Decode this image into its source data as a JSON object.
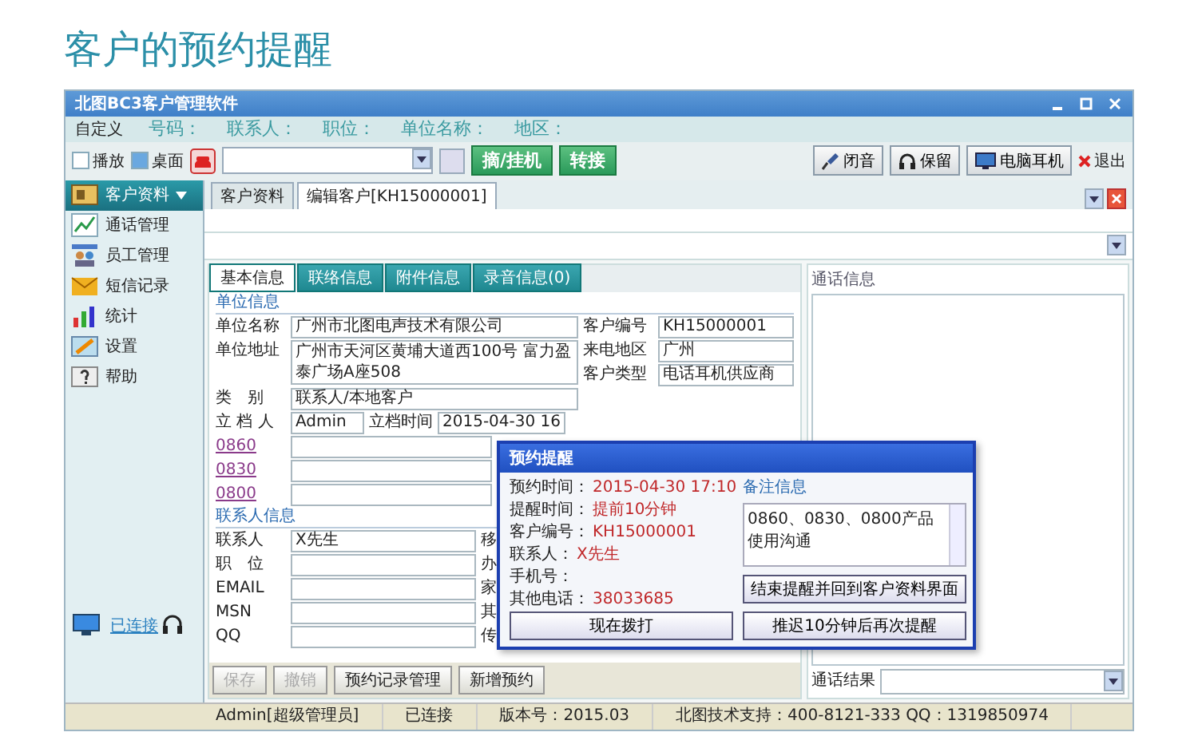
{
  "heading": "客户的预约提醒",
  "window": {
    "title": "北图BC3客户管理软件"
  },
  "info_bar": {
    "custom": "自定义",
    "fields": [
      "号码：",
      "联系人：",
      "职位：",
      "单位名称：",
      "地区："
    ]
  },
  "toolbar": {
    "checkboxes": [
      {
        "label": "播放",
        "checked": false
      },
      {
        "label": "桌面",
        "checked": true
      }
    ],
    "call_buttons": [
      "摘/挂机",
      "转接"
    ],
    "tool_buttons": [
      "闭音",
      "保留",
      "电脑耳机"
    ],
    "exit": "退出"
  },
  "sidebar": {
    "items": [
      {
        "label": "客户资料",
        "selected": true
      },
      {
        "label": "通话管理",
        "selected": false
      },
      {
        "label": "员工管理",
        "selected": false
      },
      {
        "label": "短信记录",
        "selected": false
      },
      {
        "label": "统计",
        "selected": false
      },
      {
        "label": "设置",
        "selected": false
      },
      {
        "label": "帮助",
        "selected": false
      }
    ],
    "status": "已连接"
  },
  "doc_tabs": [
    {
      "label": "客户资料",
      "selected": false
    },
    {
      "label": "编辑客户[KH15000001]",
      "selected": true
    }
  ],
  "form_tabs": [
    {
      "label": "基本信息",
      "selected": true
    },
    {
      "label": "联络信息",
      "selected": false
    },
    {
      "label": "附件信息",
      "selected": false
    },
    {
      "label": "录音信息(0)",
      "selected": false
    }
  ],
  "company": {
    "legend": "单位信息",
    "name_label": "单位名称",
    "name": "广州市北图电声技术有限公司",
    "id_label": "客户编号",
    "id": "KH15000001",
    "address_label": "单位地址",
    "address": "广州市天河区黄埔大道西100号 富力盈泰广场A座508",
    "region_label": "来电地区",
    "region": "广州",
    "type_label": "客户类型",
    "type": "电话耳机供应商",
    "category_label": "类　别",
    "category": "联系人/本地客户",
    "creator_label": "立 档 人",
    "creator": "Admin",
    "created_label": "立档时间",
    "created": "2015-04-30 16",
    "links": [
      "0860",
      "0830",
      "0800"
    ]
  },
  "contact": {
    "legend": "联系人信息",
    "rows": [
      {
        "label": "联系人",
        "value": "X先生",
        "side_label": "移"
      },
      {
        "label": "职　位",
        "side_label": "办"
      },
      {
        "label": "EMAIL",
        "side_label": "家"
      },
      {
        "label": "MSN",
        "side_label": "其"
      },
      {
        "label": "QQ",
        "side_label": "传"
      }
    ]
  },
  "form_buttons": [
    {
      "label": "保存",
      "disabled": true
    },
    {
      "label": "撤销",
      "disabled": true
    },
    {
      "label": "预约记录管理",
      "disabled": false
    },
    {
      "label": "新增预约",
      "disabled": false
    }
  ],
  "call_info": {
    "legend": "通话信息",
    "result_label": "通话结果"
  },
  "status_bar": [
    "Admin[超级管理员]",
    "已连接",
    "版本号：2015.03",
    "北图技术支持：400-8121-333 QQ：1319850974"
  ],
  "dialog": {
    "title": "预约提醒",
    "rows": [
      {
        "label": "预约时间：",
        "value": "2015-04-30 17:10"
      },
      {
        "label": "提醒时间：",
        "value": "提前10分钟"
      },
      {
        "label": "客户编号：",
        "value": "KH15000001"
      },
      {
        "label": "联系人：",
        "value": "X先生"
      },
      {
        "label": "手机号："
      },
      {
        "label": "其他电话：",
        "value": "38033685"
      }
    ],
    "note_label": "备注信息",
    "note": "0860、0830、0800产品使用沟通",
    "buttons": [
      "结束提醒并回到客户资料界面",
      "现在拨打",
      "推迟10分钟后再次提醒"
    ]
  }
}
